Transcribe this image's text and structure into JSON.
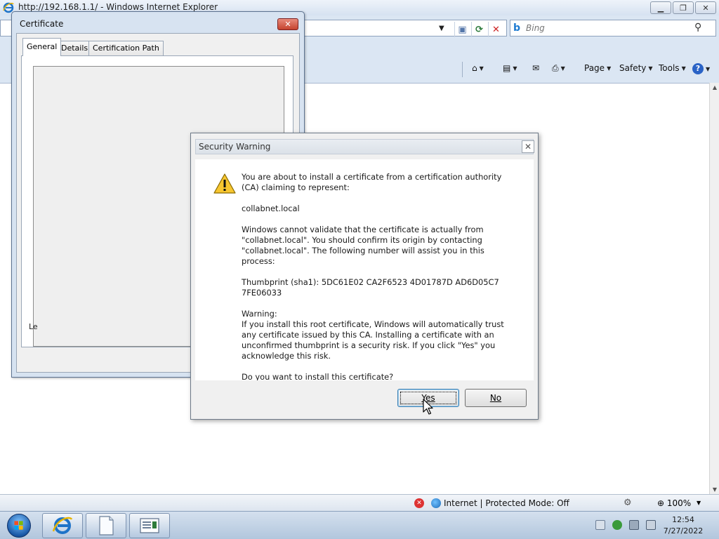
{
  "browser": {
    "title": "http://192.168.1.1/ - Windows Internet Explorer",
    "search_placeholder": "Bing",
    "commands": {
      "page": "Page",
      "safety": "Safety",
      "tools": "Tools"
    },
    "status": {
      "zone": "Internet | Protected Mode: Off",
      "zoom": "100%"
    }
  },
  "certificate_dialog": {
    "title": "Certificate",
    "tabs": [
      "General",
      "Details",
      "Certification Path"
    ],
    "learn_more_partial": "Le"
  },
  "security_warning": {
    "title": "Security Warning",
    "intro": "You are about to install a certificate from a certification authority (CA) claiming to represent:",
    "ca_name": "collabnet.local",
    "validation_note": "Windows cannot validate that the certificate is actually from \"collabnet.local\". You should confirm its origin by contacting \"collabnet.local\". The following number will assist you in this process:",
    "thumbprint": "Thumbprint (sha1): 5DC61E02 CA2F6523 4D01787D AD6D05C7 7FE06033",
    "warning_heading": "Warning:",
    "warning_body": "If you install this root certificate, Windows will automatically trust any certificate issued by this CA. Installing a certificate with an unconfirmed thumbprint is a security risk. If you click \"Yes\" you acknowledge this risk.",
    "question": "Do you want to install this certificate?",
    "yes_label": "Yes",
    "no_label": "No"
  },
  "taskbar": {
    "clock_time": "12:54",
    "clock_date": "7/27/2022"
  },
  "icons": {
    "warning": "warning-triangle-icon",
    "ie": "internet-explorer-icon",
    "start": "windows-start-orb"
  }
}
